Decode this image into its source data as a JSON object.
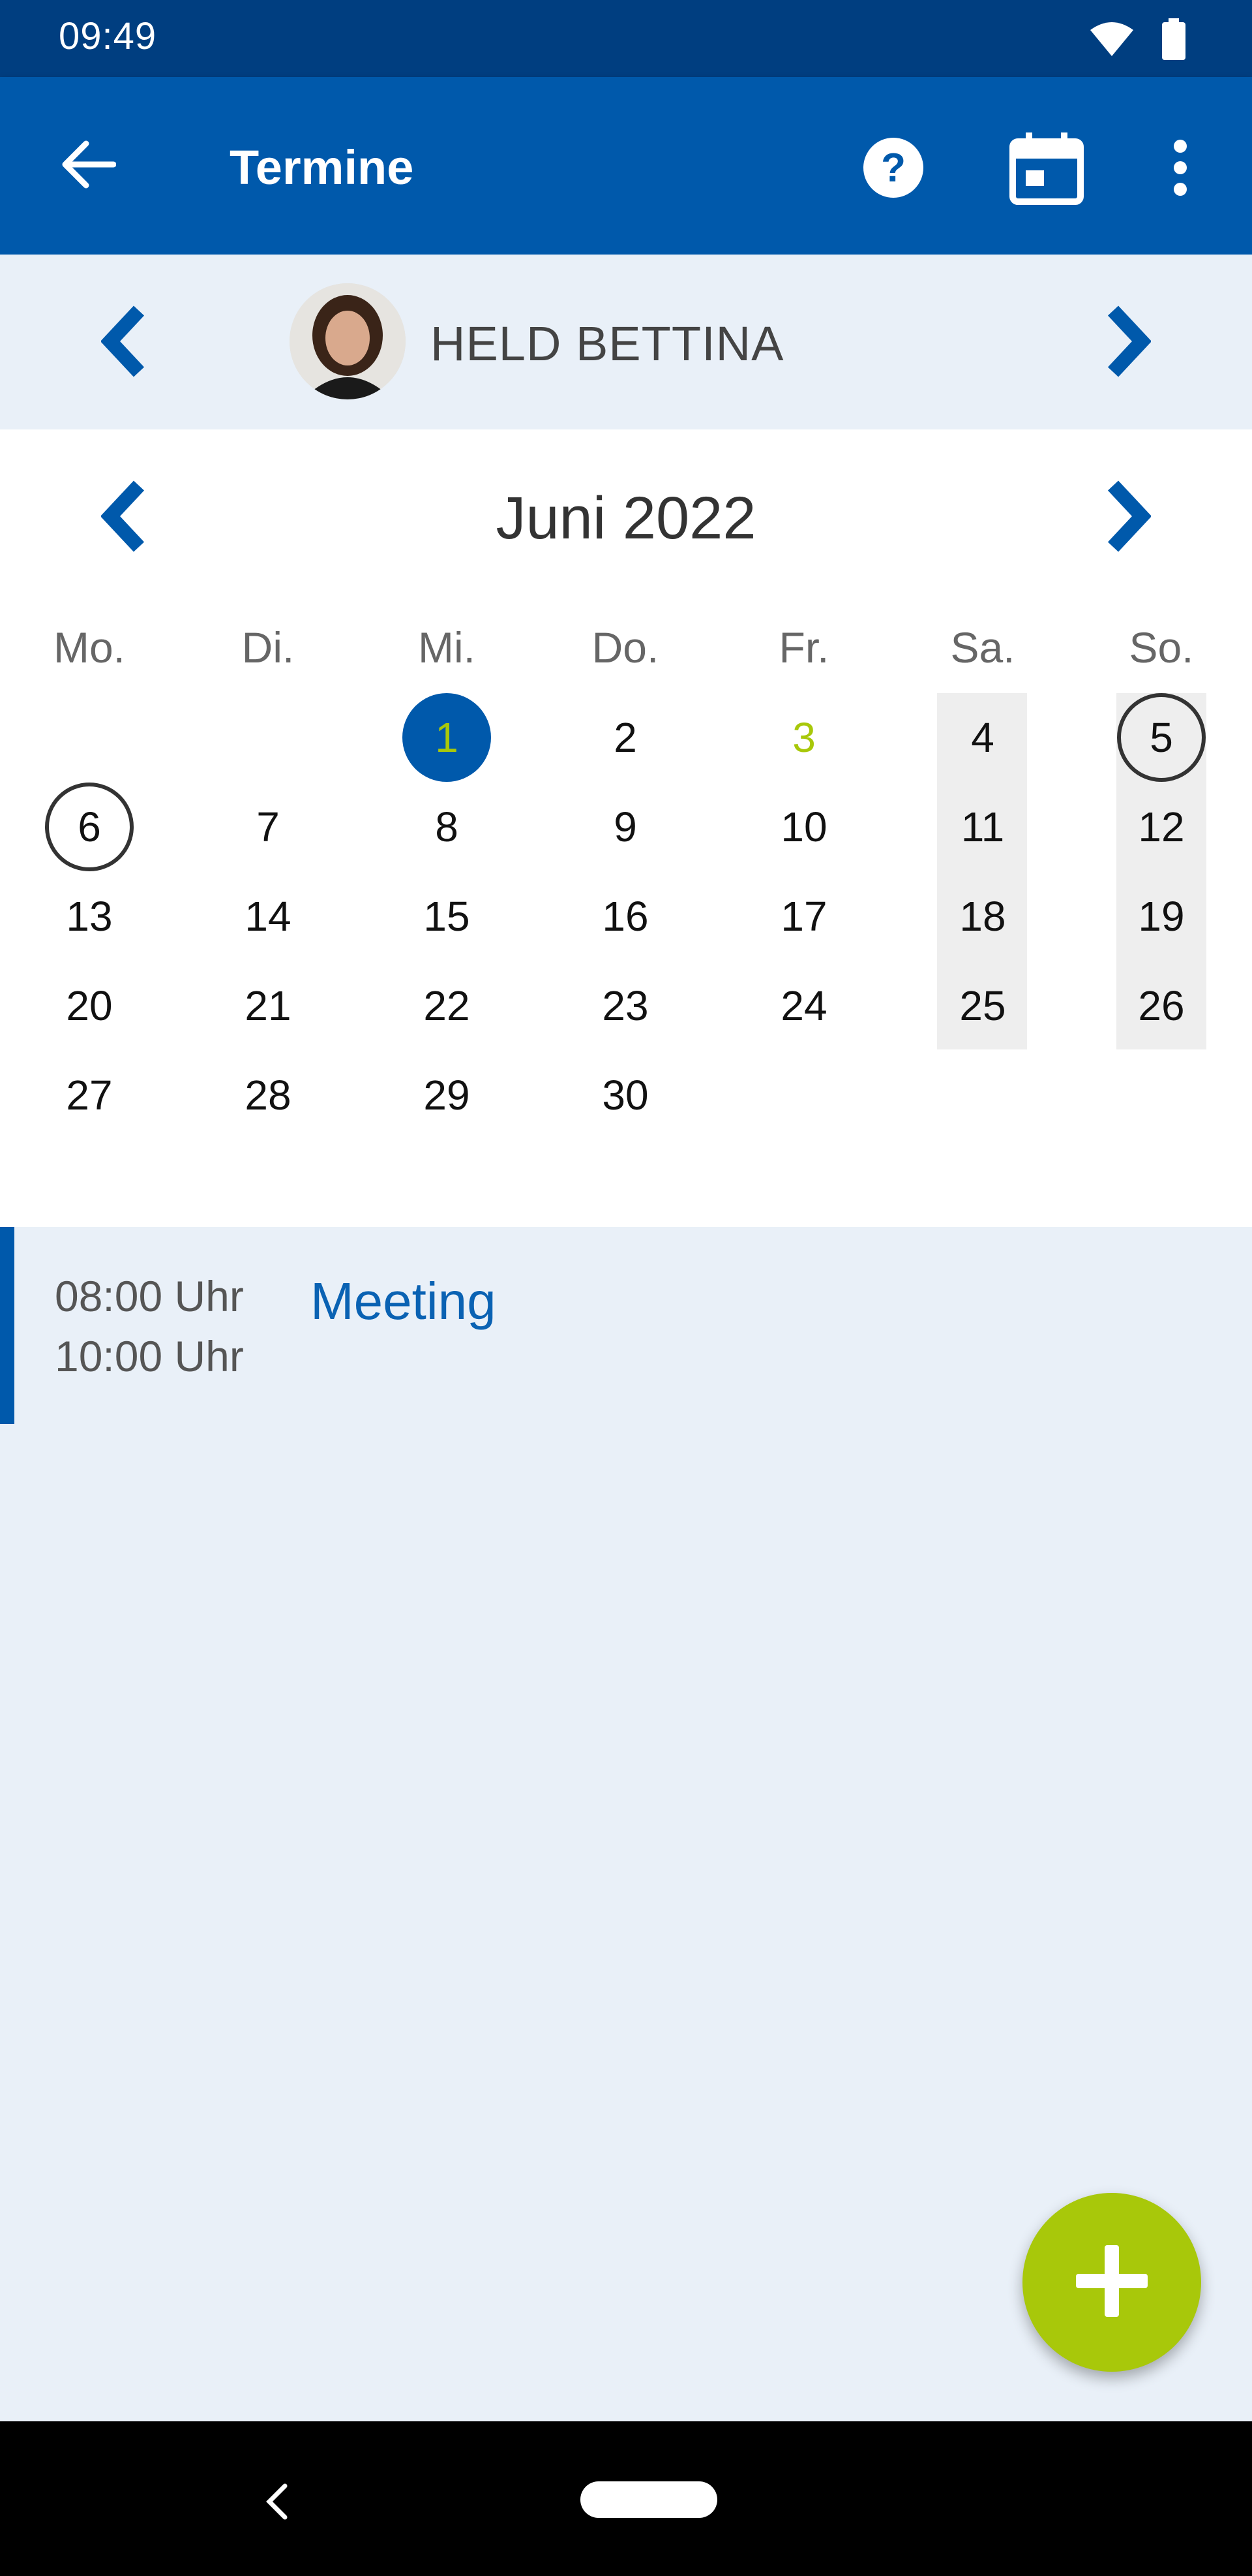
{
  "status_bar": {
    "time": "09:49",
    "icons": [
      "wifi-icon",
      "battery-icon"
    ]
  },
  "app_bar": {
    "title": "Termine",
    "icons": [
      "back-arrow-icon",
      "help-icon",
      "calendar-icon",
      "more-vert-icon"
    ]
  },
  "person": {
    "name": "HELD BETTINA",
    "icons": [
      "chevron-left-icon",
      "chevron-right-icon"
    ]
  },
  "calendar": {
    "month_title": "Juni 2022",
    "weekdays": [
      "Mo.",
      "Di.",
      "Mi.",
      "Do.",
      "Fr.",
      "Sa.",
      "So."
    ],
    "days": [
      "1",
      "2",
      "3",
      "4",
      "5",
      "6",
      "7",
      "8",
      "9",
      "10",
      "11",
      "12",
      "13",
      "14",
      "15",
      "16",
      "17",
      "18",
      "19",
      "20",
      "21",
      "22",
      "23",
      "24",
      "25",
      "26",
      "27",
      "28",
      "29",
      "30"
    ],
    "today": "1",
    "green_day": "3",
    "ringed_days": [
      "5",
      "6"
    ]
  },
  "events": [
    {
      "start": "08:00 Uhr",
      "end": "10:00 Uhr",
      "title": "Meeting"
    }
  ],
  "colors": {
    "primary": "#0059ab",
    "status_bar": "#003e80",
    "accent": "#a8c80a",
    "background": "#e9f0f8"
  },
  "fab": {
    "icon": "plus-icon"
  },
  "nav_bar": {
    "icons": [
      "nav-back-icon",
      "nav-home-pill"
    ]
  }
}
